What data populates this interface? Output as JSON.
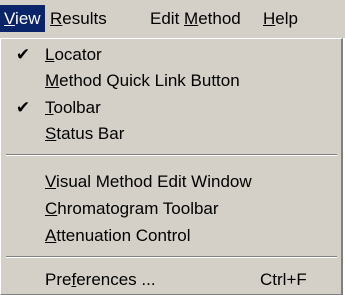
{
  "menubar": {
    "items": [
      {
        "mnemonic": "V",
        "rest": "iew"
      },
      {
        "mnemonic": "R",
        "rest": "esults"
      },
      {
        "pre": "Edit ",
        "mnemonic": "M",
        "rest": "ethod"
      },
      {
        "mnemonic": "H",
        "rest": "elp"
      }
    ]
  },
  "menu": {
    "group1": [
      {
        "check": "✔",
        "mnemonic": "L",
        "rest": "ocator"
      },
      {
        "mnemonic": "M",
        "rest": "ethod Quick Link Button"
      },
      {
        "check": "✔",
        "mnemonic": "T",
        "rest": "oolbar"
      },
      {
        "mnemonic": "S",
        "rest": "tatus Bar"
      }
    ],
    "group2": [
      {
        "mnemonic": "V",
        "rest": "isual Method Edit Window"
      },
      {
        "mnemonic": "C",
        "rest": "hromatogram Toolbar"
      },
      {
        "mnemonic": "A",
        "rest": "ttenuation Control"
      }
    ],
    "group3": [
      {
        "pre": "Pre",
        "mnemonic": "f",
        "rest": "erences ...",
        "shortcut": "Ctrl+F"
      }
    ]
  },
  "colors": {
    "menu_bg": "#d4d0c8",
    "highlight": "#0a246a"
  }
}
